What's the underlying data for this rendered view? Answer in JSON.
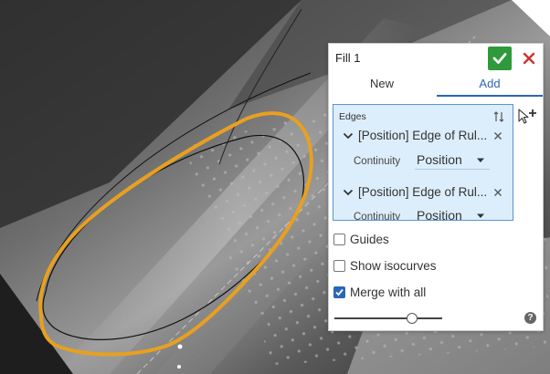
{
  "dialog": {
    "title": "Fill 1",
    "ok_icon": "checkmark-icon",
    "cancel_icon": "close-icon",
    "tabs": [
      {
        "label": "New",
        "active": false
      },
      {
        "label": "Add",
        "active": true
      }
    ],
    "edges": {
      "label": "Edges",
      "items": [
        {
          "label": "[Position] Edge of Rul...",
          "continuity_label": "Continuity",
          "continuity_value": "Position"
        },
        {
          "label": "[Position] Edge of Rul...",
          "continuity_label": "Continuity",
          "continuity_value": "Position"
        }
      ]
    },
    "options": {
      "guides": {
        "label": "Guides",
        "checked": false
      },
      "show_isocurves": {
        "label": "Show isocurves",
        "checked": false
      },
      "merge_with_all": {
        "label": "Merge with all",
        "checked": true
      }
    },
    "slider_value": 0.72,
    "help_icon": "help-icon"
  },
  "colors": {
    "accent": "#2b66b8",
    "ok": "#2e9a3c",
    "cancel": "#d0312d",
    "highlight_curve": "#e8a020",
    "selection_bg": "#dceefc"
  }
}
